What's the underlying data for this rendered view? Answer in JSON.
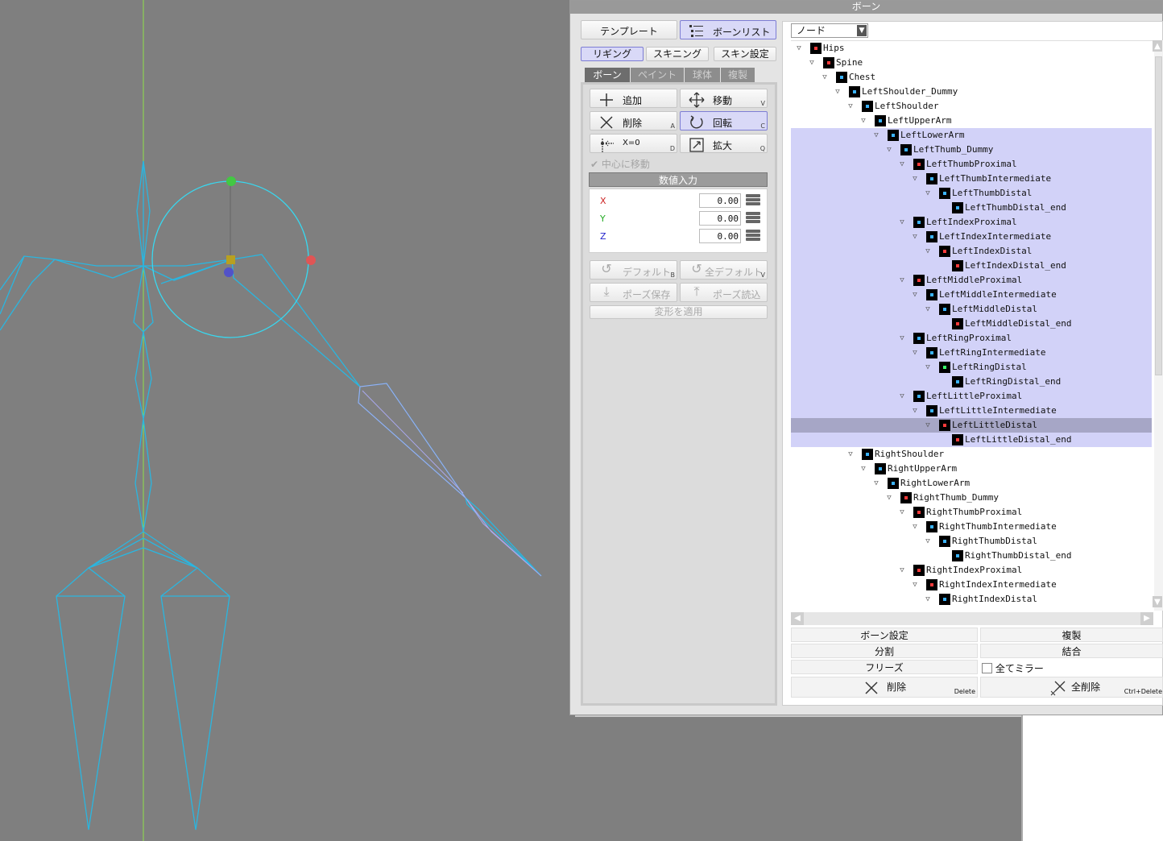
{
  "panel": {
    "title": "ボーン"
  },
  "top_buttons": {
    "template": "テンプレート",
    "bone_list": "ボーンリスト"
  },
  "mode_tabs": [
    "リギング",
    "スキニング",
    "スキン設定"
  ],
  "sub_tabs": [
    "ボーン",
    "ペイント",
    "球体",
    "複製"
  ],
  "tools": {
    "add": "追加",
    "move": "移動",
    "move_key": "V",
    "delete": "削除",
    "delete_key": "A",
    "rotate": "回転",
    "rotate_key": "C",
    "x0": "X=0",
    "x0_key": "D",
    "scale": "拡大",
    "scale_key": "Q"
  },
  "center_move": "中心に移動",
  "numeric_input": {
    "label": "数値入力",
    "fields": [
      {
        "axis": "X",
        "value": "0.00",
        "color": "#cc2222"
      },
      {
        "axis": "Y",
        "value": "0.00",
        "color": "#22aa22"
      },
      {
        "axis": "Z",
        "value": "0.00",
        "color": "#2222cc"
      }
    ]
  },
  "pose": {
    "default": "デフォルト",
    "default_key": "B",
    "all_default": "全デフォルト",
    "all_default_key": "V",
    "save": "ポーズ保存",
    "load": "ポーズ読込",
    "apply": "変形を適用"
  },
  "node_select": "ノード",
  "tree": [
    {
      "name": "Hips",
      "depth": 0,
      "state": "normal",
      "dot": "#ff3b3b"
    },
    {
      "name": "Spine",
      "depth": 1,
      "state": "normal",
      "dot": "#ff3b3b"
    },
    {
      "name": "Chest",
      "depth": 2,
      "state": "normal",
      "dot": "#3bb3ff"
    },
    {
      "name": "LeftShoulder_Dummy",
      "depth": 3,
      "state": "normal",
      "dot": "#3bb3ff"
    },
    {
      "name": "LeftShoulder",
      "depth": 4,
      "state": "normal",
      "dot": "#3bb3ff"
    },
    {
      "name": "LeftUpperArm",
      "depth": 5,
      "state": "normal",
      "dot": "#3bb3ff"
    },
    {
      "name": "LeftLowerArm",
      "depth": 6,
      "state": "sel",
      "dot": "#3bb3ff"
    },
    {
      "name": "LeftThumb_Dummy",
      "depth": 7,
      "state": "sel",
      "dot": "#3bb3ff"
    },
    {
      "name": "LeftThumbProximal",
      "depth": 8,
      "state": "sel",
      "dot": "#ff3b3b"
    },
    {
      "name": "LeftThumbIntermediate",
      "depth": 9,
      "state": "sel",
      "dot": "#3bb3ff"
    },
    {
      "name": "LeftThumbDistal",
      "depth": 10,
      "state": "sel",
      "dot": "#3bb3ff"
    },
    {
      "name": "LeftThumbDistal_end",
      "depth": 11,
      "state": "sel",
      "dot": "#3bb3ff"
    },
    {
      "name": "LeftIndexProximal",
      "depth": 8,
      "state": "sel",
      "dot": "#3bb3ff"
    },
    {
      "name": "LeftIndexIntermediate",
      "depth": 9,
      "state": "sel",
      "dot": "#3bb3ff"
    },
    {
      "name": "LeftIndexDistal",
      "depth": 10,
      "state": "sel",
      "dot": "#ff3b3b"
    },
    {
      "name": "LeftIndexDistal_end",
      "depth": 11,
      "state": "sel",
      "dot": "#ff3b3b"
    },
    {
      "name": "LeftMiddleProximal",
      "depth": 8,
      "state": "sel",
      "dot": "#ff3b3b"
    },
    {
      "name": "LeftMiddleIntermediate",
      "depth": 9,
      "state": "sel",
      "dot": "#3bb3ff"
    },
    {
      "name": "LeftMiddleDistal",
      "depth": 10,
      "state": "sel",
      "dot": "#3bb3ff"
    },
    {
      "name": "LeftMiddleDistal_end",
      "depth": 11,
      "state": "sel",
      "dot": "#ff3b3b"
    },
    {
      "name": "LeftRingProximal",
      "depth": 8,
      "state": "sel",
      "dot": "#3bb3ff"
    },
    {
      "name": "LeftRingIntermediate",
      "depth": 9,
      "state": "sel",
      "dot": "#3bb3ff"
    },
    {
      "name": "LeftRingDistal",
      "depth": 10,
      "state": "sel",
      "dot": "#3bff6b"
    },
    {
      "name": "LeftRingDistal_end",
      "depth": 11,
      "state": "sel",
      "dot": "#3bb3ff"
    },
    {
      "name": "LeftLittleProximal",
      "depth": 8,
      "state": "sel",
      "dot": "#3bb3ff"
    },
    {
      "name": "LeftLittleIntermediate",
      "depth": 9,
      "state": "sel",
      "dot": "#3bb3ff"
    },
    {
      "name": "LeftLittleDistal",
      "depth": 10,
      "state": "cur",
      "dot": "#ff3b3b"
    },
    {
      "name": "LeftLittleDistal_end",
      "depth": 11,
      "state": "sel",
      "dot": "#ff3b3b"
    },
    {
      "name": "RightShoulder",
      "depth": 4,
      "state": "normal",
      "dot": "#3bb3ff"
    },
    {
      "name": "RightUpperArm",
      "depth": 5,
      "state": "normal",
      "dot": "#3bb3ff"
    },
    {
      "name": "RightLowerArm",
      "depth": 6,
      "state": "normal",
      "dot": "#3bb3ff"
    },
    {
      "name": "RightThumb_Dummy",
      "depth": 7,
      "state": "normal",
      "dot": "#ff3b3b"
    },
    {
      "name": "RightThumbProximal",
      "depth": 8,
      "state": "normal",
      "dot": "#ff3b3b"
    },
    {
      "name": "RightThumbIntermediate",
      "depth": 9,
      "state": "normal",
      "dot": "#3bb3ff"
    },
    {
      "name": "RightThumbDistal",
      "depth": 10,
      "state": "normal",
      "dot": "#3bb3ff"
    },
    {
      "name": "RightThumbDistal_end",
      "depth": 11,
      "state": "normal",
      "dot": "#3bb3ff"
    },
    {
      "name": "RightIndexProximal",
      "depth": 8,
      "state": "normal",
      "dot": "#ff3b3b"
    },
    {
      "name": "RightIndexIntermediate",
      "depth": 9,
      "state": "normal",
      "dot": "#ff3b3b"
    },
    {
      "name": "RightIndexDistal",
      "depth": 10,
      "state": "normal",
      "dot": "#3bb3ff"
    }
  ],
  "bottom": {
    "bone_settings": "ボーン設定",
    "duplicate": "複製",
    "split": "分割",
    "merge": "結合",
    "freeze": "フリーズ",
    "mirror_all": "全てミラー",
    "delete": "削除",
    "delete_key": "Delete",
    "delete_all": "全削除",
    "delete_all_key": "Ctrl+Delete"
  }
}
